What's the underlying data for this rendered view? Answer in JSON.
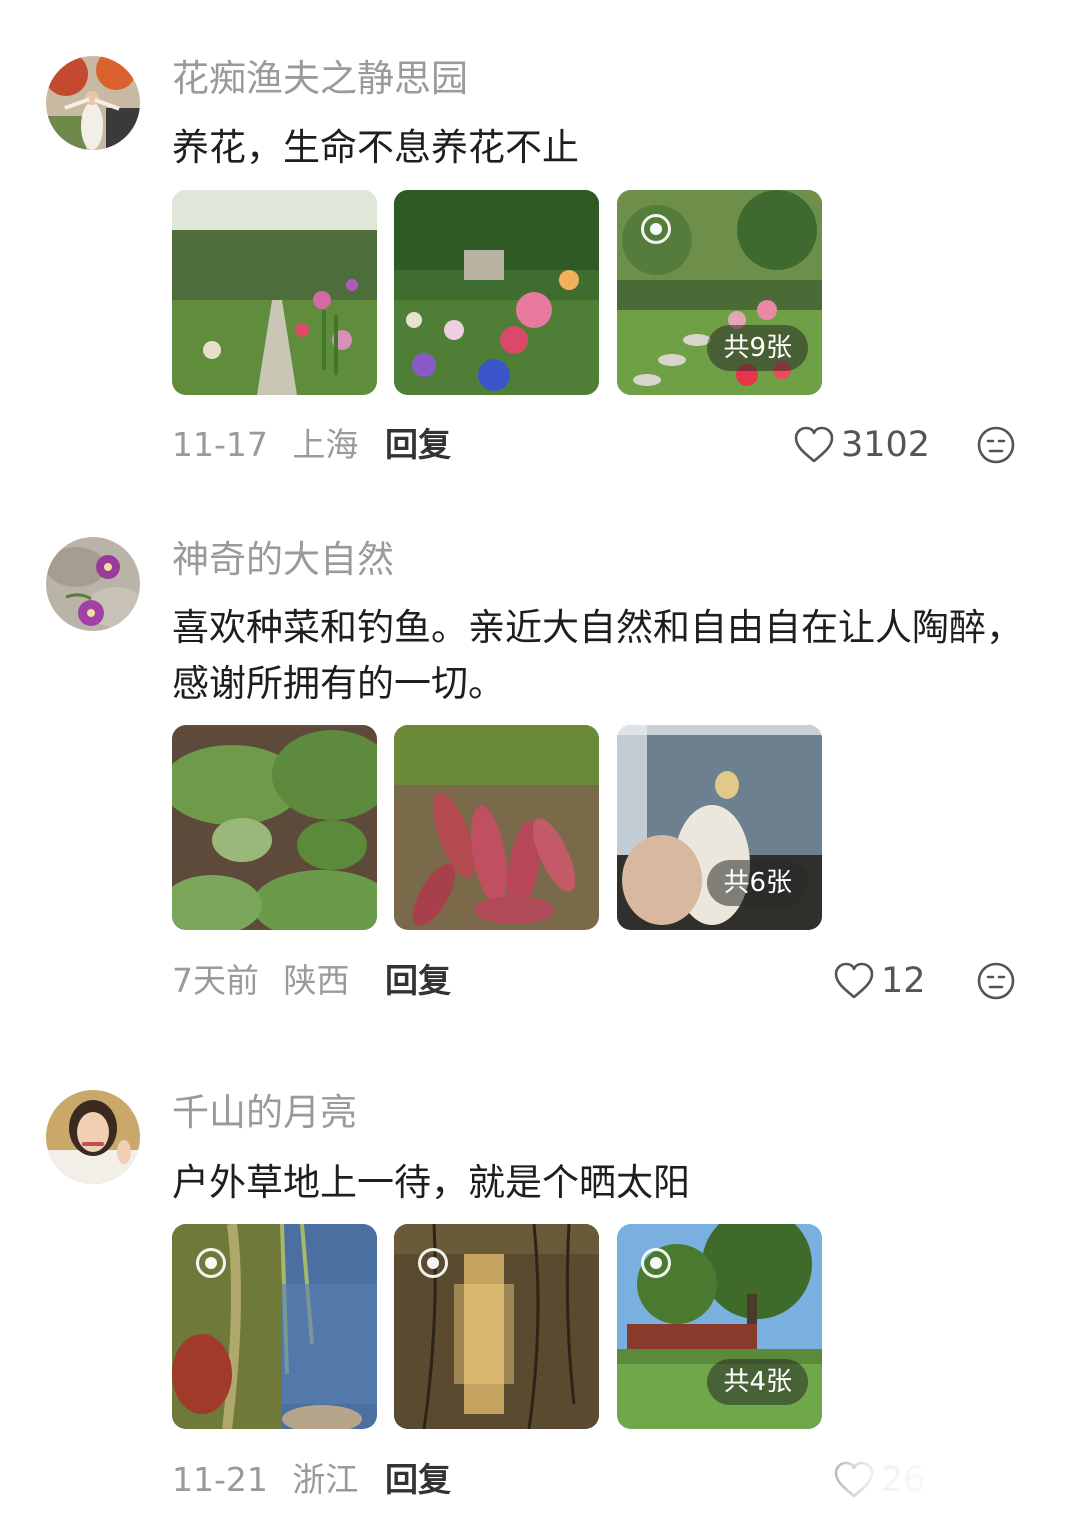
{
  "comments": [
    {
      "username": "花痴渔夫之静思园",
      "text": "养花，生命不息养花不止",
      "image_count_badge": "共9张",
      "date": "11-17",
      "location": "上海",
      "reply_label": "回复",
      "likes": "3102"
    },
    {
      "username": "神奇的大自然",
      "text": "喜欢种菜和钓鱼。亲近大自然和自由自在让人陶醉，感谢所拥有的一切。",
      "image_count_badge": "共6张",
      "date": "7天前",
      "location": "陕西",
      "reply_label": "回复",
      "likes": "12"
    },
    {
      "username": "千山的月亮",
      "text": "户外草地上一待，就是个晒太阳",
      "image_count_badge": "共4张",
      "date": "11-21",
      "location": "浙江",
      "reply_label": "回复",
      "likes": "26"
    }
  ],
  "colors": {
    "username": "#9a9a9a",
    "content": "#1e1e1e",
    "meta": "#9a9a9a",
    "reply": "#333333"
  }
}
